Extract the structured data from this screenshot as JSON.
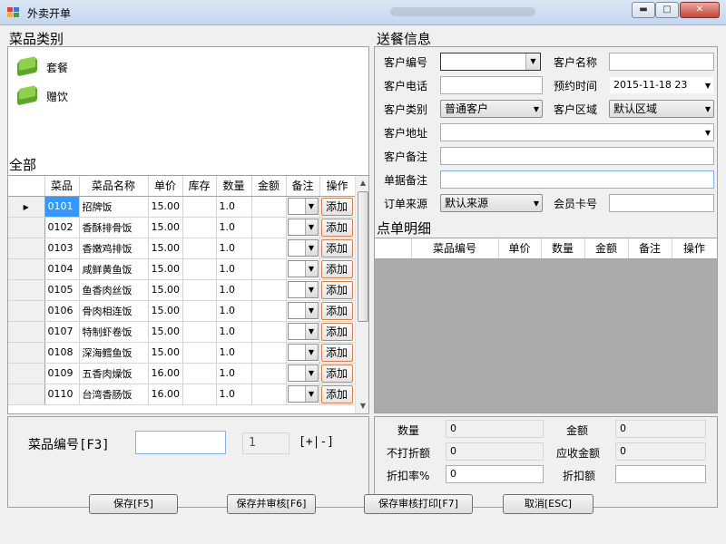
{
  "window": {
    "title": "外卖开单"
  },
  "category": {
    "title": "菜品类别",
    "items": [
      {
        "label": "套餐"
      },
      {
        "label": "赠饮"
      }
    ]
  },
  "all": {
    "title": "全部",
    "columns": [
      "菜品",
      "菜品名称",
      "单价",
      "库存",
      "数量",
      "金额",
      "备注",
      "操作"
    ],
    "add_label": "添加",
    "rows": [
      {
        "code": "0101",
        "name": "招牌饭",
        "price": "15.00",
        "qty": "1.0"
      },
      {
        "code": "0102",
        "name": "香酥排骨饭",
        "price": "15.00",
        "qty": "1.0"
      },
      {
        "code": "0103",
        "name": "香嫩鸡排饭",
        "price": "15.00",
        "qty": "1.0"
      },
      {
        "code": "0104",
        "name": "咸鲜黄鱼饭",
        "price": "15.00",
        "qty": "1.0"
      },
      {
        "code": "0105",
        "name": "鱼香肉丝饭",
        "price": "15.00",
        "qty": "1.0"
      },
      {
        "code": "0106",
        "name": "骨肉相连饭",
        "price": "15.00",
        "qty": "1.0"
      },
      {
        "code": "0107",
        "name": "特制虾卷饭",
        "price": "15.00",
        "qty": "1.0"
      },
      {
        "code": "0108",
        "name": "深海鳕鱼饭",
        "price": "15.00",
        "qty": "1.0"
      },
      {
        "code": "0109",
        "name": "五香肉燥饭",
        "price": "16.00",
        "qty": "1.0"
      },
      {
        "code": "0110",
        "name": "台湾香肠饭",
        "price": "16.00",
        "qty": "1.0"
      }
    ]
  },
  "dish_entry": {
    "label": "菜品编号[F3]",
    "value": "",
    "count": "1",
    "plusminus": "[+|-]"
  },
  "delivery": {
    "title": "送餐信息",
    "customer_no": "客户编号",
    "customer_name": "客户名称",
    "phone": "客户电话",
    "reserve_time": "预约时间",
    "reserve_value": "2015-11-18 23",
    "customer_type": "客户类别",
    "customer_type_value": "普通客户",
    "region": "客户区域",
    "region_value": "默认区域",
    "address": "客户地址",
    "cust_note": "客户备注",
    "order_note": "单据备注",
    "source": "订单来源",
    "source_value": "默认来源",
    "member_card": "会员卡号"
  },
  "order_detail": {
    "title": "点单明细",
    "columns": [
      "菜品编号",
      "单价",
      "数量",
      "金额",
      "备注",
      "操作"
    ]
  },
  "summary": {
    "qty_label": "数量",
    "qty_value": "0",
    "amount_label": "金额",
    "amount_value": "0",
    "nodisc_label": "不打折额",
    "nodisc_value": "0",
    "receivable_label": "应收金额",
    "receivable_value": "0",
    "rate_label": "折扣率%",
    "rate_value": "0",
    "disc_label": "折扣额",
    "disc_value": ""
  },
  "buttons": {
    "save": "保存[F5]",
    "save_audit": "保存并审核[F6]",
    "save_audit_print": "保存审核打印[F7]",
    "cancel": "取消[ESC]"
  }
}
